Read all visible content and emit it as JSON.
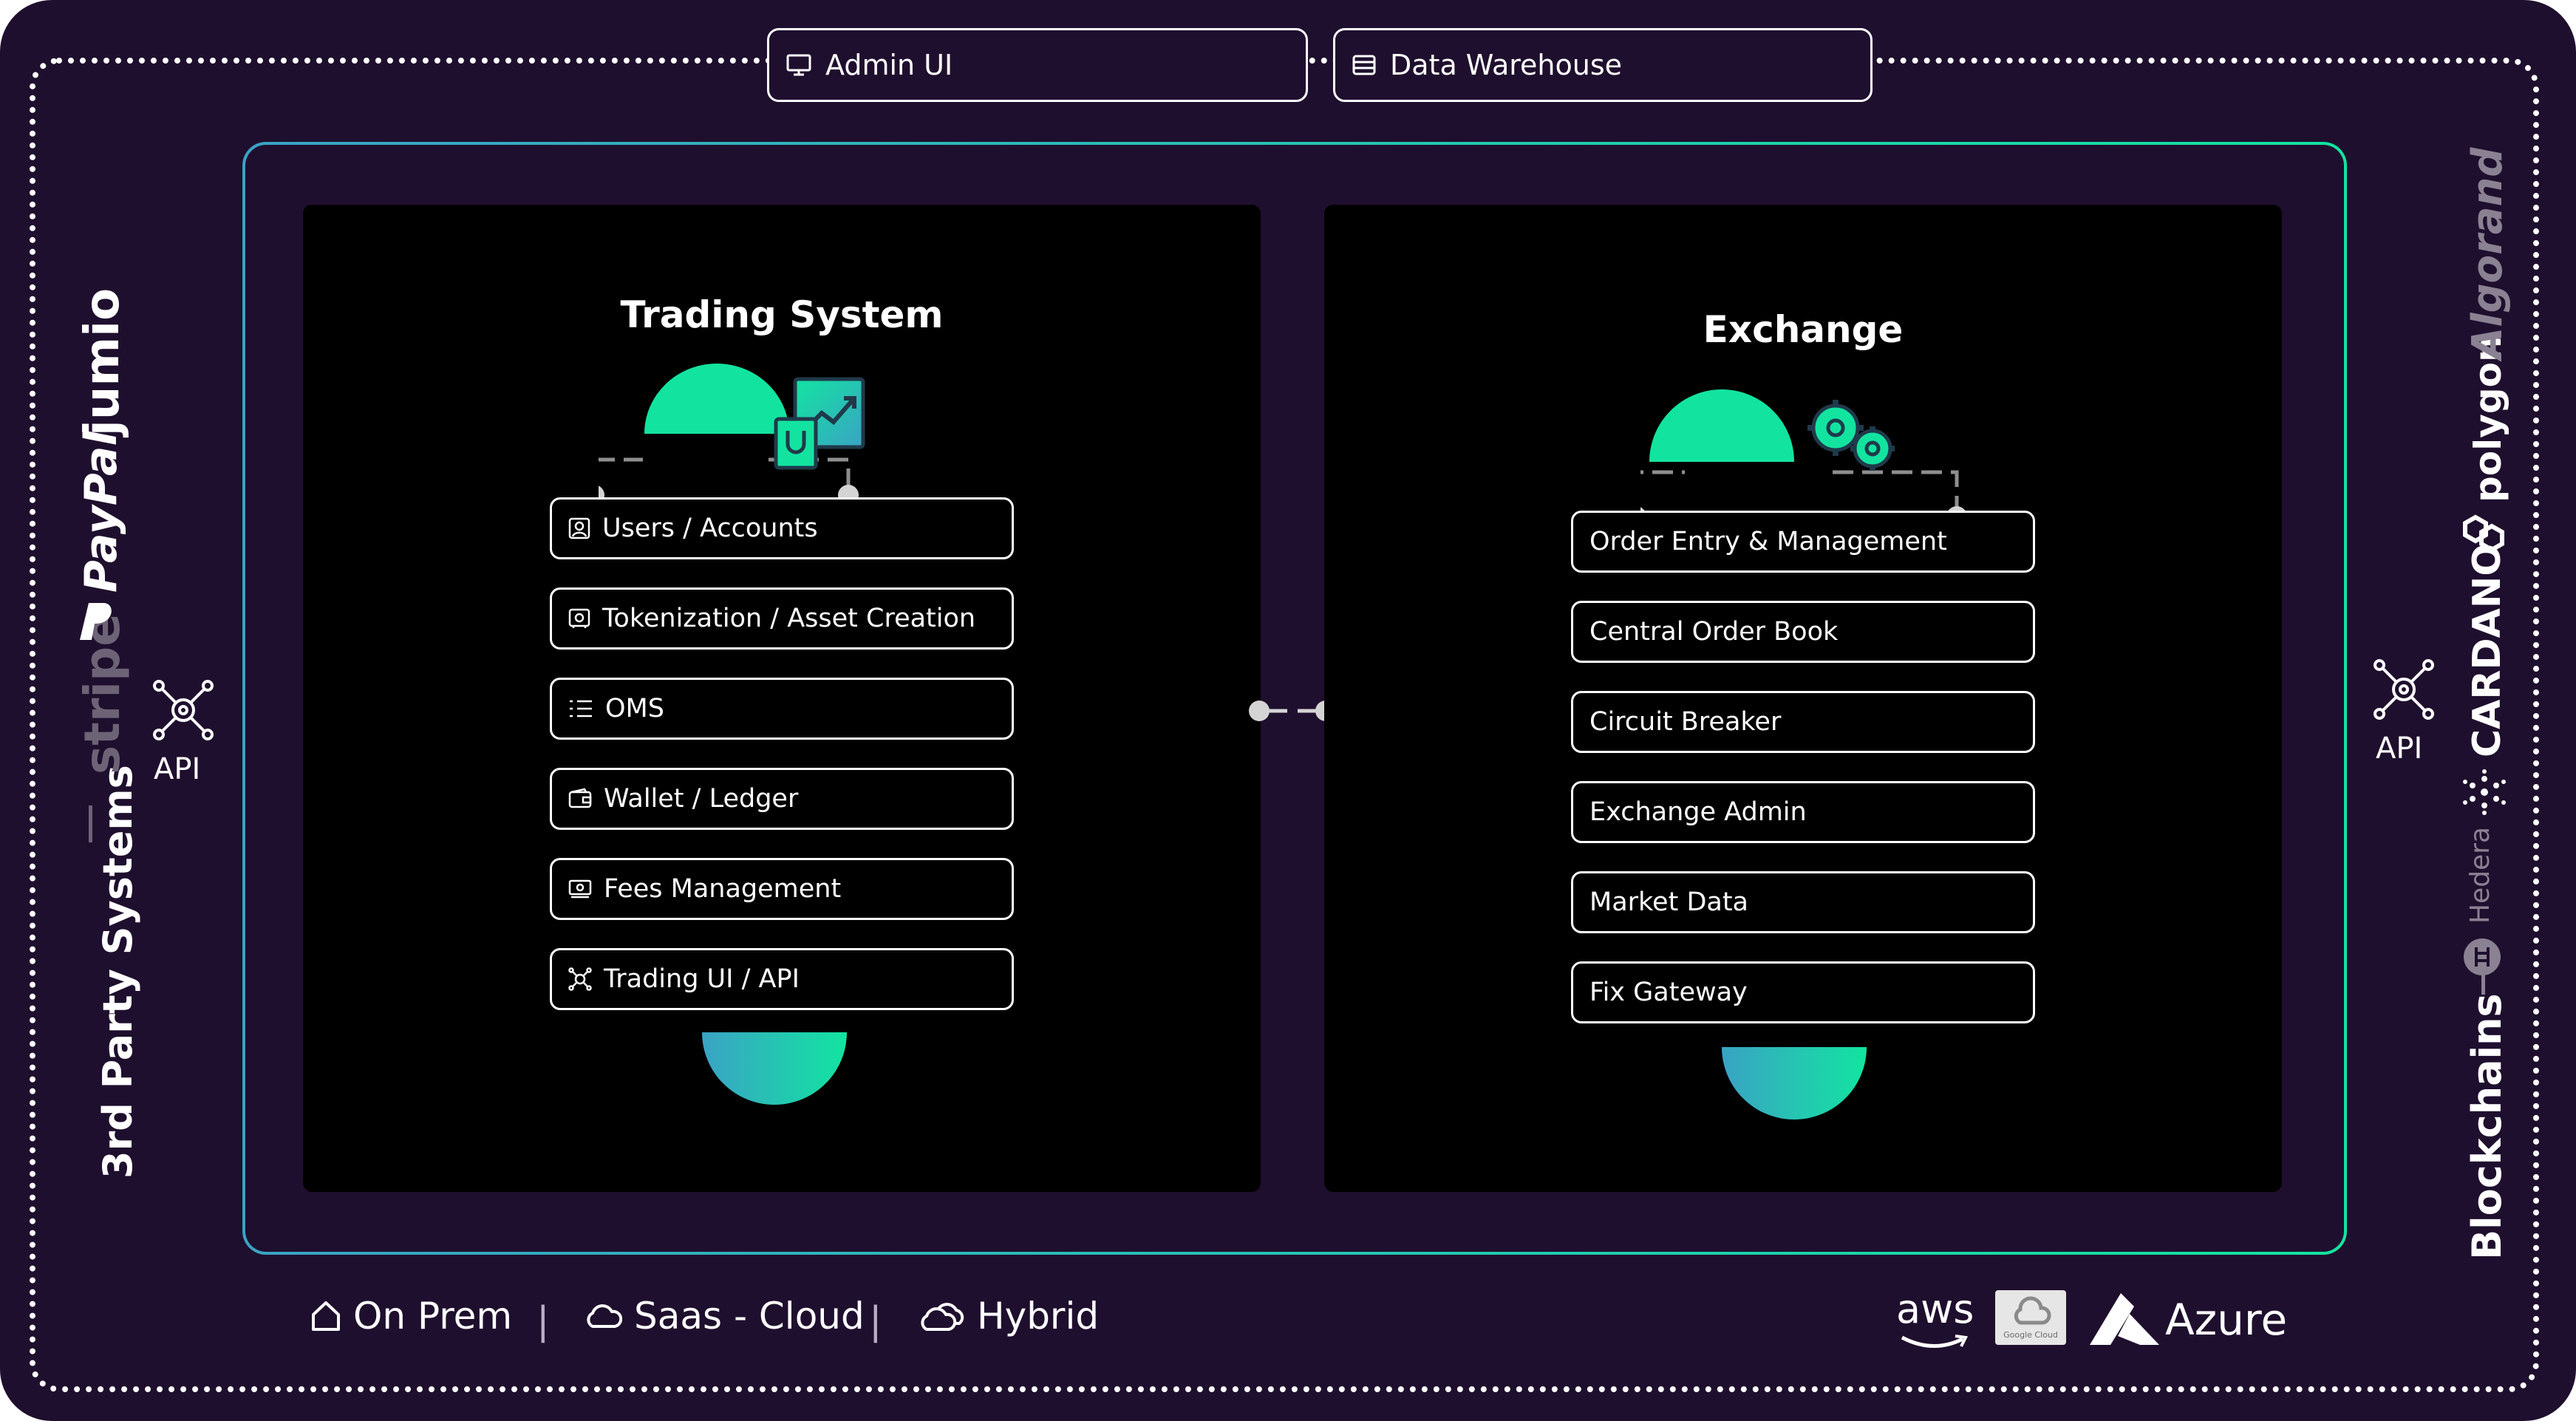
{
  "top": {
    "admin_ui": "Admin UI",
    "data_warehouse": "Data Warehouse"
  },
  "left": {
    "title": "3rd Party Systems",
    "api_label": "API",
    "logos": [
      "stripe",
      "PayPal",
      "jumio"
    ]
  },
  "right": {
    "title": "Blockchains",
    "api_label": "API",
    "logos": [
      "Hedera",
      "CARDANO",
      "polygon",
      "Algorand"
    ]
  },
  "trading": {
    "title": "Trading System",
    "items": [
      {
        "label": "Users / Accounts",
        "icon": "user-icon"
      },
      {
        "label": "Tokenization / Asset Creation",
        "icon": "safe-icon"
      },
      {
        "label": "OMS",
        "icon": "list-icon"
      },
      {
        "label": "Wallet / Ledger",
        "icon": "wallet-icon"
      },
      {
        "label": "Fees Management",
        "icon": "money-icon"
      },
      {
        "label": "Trading UI / API",
        "icon": "network-icon"
      }
    ]
  },
  "exchange": {
    "title": "Exchange",
    "items": [
      {
        "label": "Order Entry & Management"
      },
      {
        "label": "Central Order Book"
      },
      {
        "label": "Circuit Breaker"
      },
      {
        "label": "Exchange Admin"
      },
      {
        "label": "Market Data"
      },
      {
        "label": "Fix Gateway"
      }
    ]
  },
  "deployment": {
    "on_prem": "On Prem",
    "saas": "Saas - Cloud",
    "hybrid": "Hybrid"
  },
  "clouds": {
    "aws": "aws",
    "google": "Google Cloud",
    "azure": "Azure"
  },
  "colors": {
    "background": "#1f0f2e",
    "accent_green": "#12e4a0",
    "accent_teal": "#3aa3c4",
    "panel": "#000000"
  }
}
